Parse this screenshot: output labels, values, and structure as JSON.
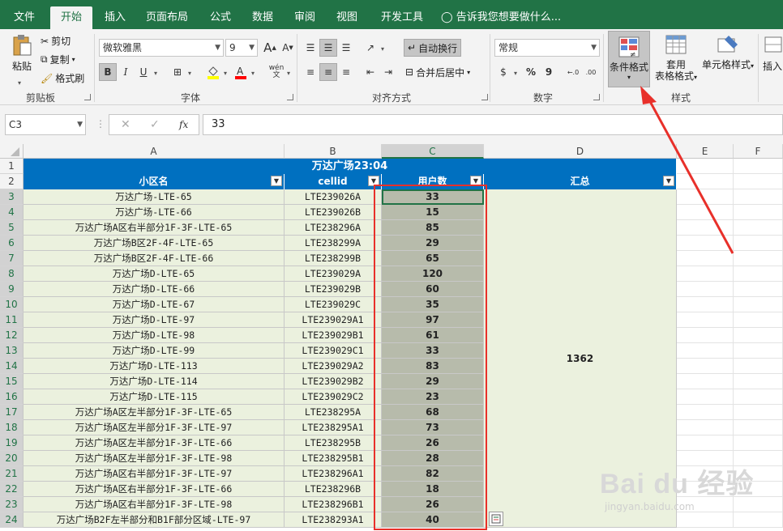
{
  "tabs": [
    {
      "label": "文件",
      "active": false
    },
    {
      "label": "开始",
      "active": true
    },
    {
      "label": "插入",
      "active": false
    },
    {
      "label": "页面布局",
      "active": false
    },
    {
      "label": "公式",
      "active": false
    },
    {
      "label": "数据",
      "active": false
    },
    {
      "label": "审阅",
      "active": false
    },
    {
      "label": "视图",
      "active": false
    },
    {
      "label": "开发工具",
      "active": false
    }
  ],
  "tell_me": "告诉我您想要做什么...",
  "ribbon": {
    "clipboard": {
      "paste": "粘贴",
      "cut": "剪切",
      "copy": "复制",
      "format_painter": "格式刷",
      "label": "剪贴板"
    },
    "font": {
      "name": "微软雅黑",
      "size": "9",
      "bold": "B",
      "italic": "I",
      "underline": "U",
      "grow": "A",
      "shrink": "A",
      "phonetic": "wén",
      "label": "字体"
    },
    "alignment": {
      "wrap": "自动换行",
      "merge": "合并后居中",
      "label": "对齐方式"
    },
    "number": {
      "format": "常规",
      "percent": "%",
      "comma": "9",
      "inc_dec": ".00",
      "label": "数字"
    },
    "styles": {
      "conditional": "条件格式",
      "table_l1": "套用",
      "table_l2": "表格格式",
      "cell_styles": "单元格样式",
      "label": "样式"
    },
    "insert": "插入"
  },
  "formula_bar": {
    "name_box": "C3",
    "fx": "fx",
    "value": "33"
  },
  "columns": [
    {
      "label": "A",
      "selected": false
    },
    {
      "label": "B",
      "selected": false
    },
    {
      "label": "C",
      "selected": true
    },
    {
      "label": "D",
      "selected": false
    },
    {
      "label": "E",
      "selected": false
    },
    {
      "label": "F",
      "selected": false
    }
  ],
  "sheet": {
    "title": "万达广场23:04",
    "headers": [
      "小区名",
      "cellid",
      "用户数",
      "汇总"
    ],
    "total": "1362",
    "rows": [
      {
        "num": "3",
        "name": "万达广场-LTE-65",
        "cellid": "LTE239026A",
        "users": "33"
      },
      {
        "num": "4",
        "name": "万达广场-LTE-66",
        "cellid": "LTE239026B",
        "users": "15"
      },
      {
        "num": "5",
        "name": "万达广场A区右半部分1F-3F-LTE-65",
        "cellid": "LTE238296A",
        "users": "85"
      },
      {
        "num": "6",
        "name": "万达广场B区2F-4F-LTE-65",
        "cellid": "LTE238299A",
        "users": "29"
      },
      {
        "num": "7",
        "name": "万达广场B区2F-4F-LTE-66",
        "cellid": "LTE238299B",
        "users": "65"
      },
      {
        "num": "8",
        "name": "万达广场D-LTE-65",
        "cellid": "LTE239029A",
        "users": "120"
      },
      {
        "num": "9",
        "name": "万达广场D-LTE-66",
        "cellid": "LTE239029B",
        "users": "60"
      },
      {
        "num": "10",
        "name": "万达广场D-LTE-67",
        "cellid": "LTE239029C",
        "users": "35"
      },
      {
        "num": "11",
        "name": "万达广场D-LTE-97",
        "cellid": "LTE239029A1",
        "users": "97"
      },
      {
        "num": "12",
        "name": "万达广场D-LTE-98",
        "cellid": "LTE239029B1",
        "users": "61"
      },
      {
        "num": "13",
        "name": "万达广场D-LTE-99",
        "cellid": "LTE239029C1",
        "users": "33"
      },
      {
        "num": "14",
        "name": "万达广场D-LTE-113",
        "cellid": "LTE239029A2",
        "users": "83"
      },
      {
        "num": "15",
        "name": "万达广场D-LTE-114",
        "cellid": "LTE239029B2",
        "users": "29"
      },
      {
        "num": "16",
        "name": "万达广场D-LTE-115",
        "cellid": "LTE239029C2",
        "users": "23"
      },
      {
        "num": "17",
        "name": "万达广场A区左半部分1F-3F-LTE-65",
        "cellid": "LTE238295A",
        "users": "68"
      },
      {
        "num": "18",
        "name": "万达广场A区左半部分1F-3F-LTE-97",
        "cellid": "LTE238295A1",
        "users": "73"
      },
      {
        "num": "19",
        "name": "万达广场A区左半部分1F-3F-LTE-66",
        "cellid": "LTE238295B",
        "users": "26"
      },
      {
        "num": "20",
        "name": "万达广场A区左半部分1F-3F-LTE-98",
        "cellid": "LTE238295B1",
        "users": "28"
      },
      {
        "num": "21",
        "name": "万达广场A区右半部分1F-3F-LTE-97",
        "cellid": "LTE238296A1",
        "users": "82"
      },
      {
        "num": "22",
        "name": "万达广场A区右半部分1F-3F-LTE-66",
        "cellid": "LTE238296B",
        "users": "18"
      },
      {
        "num": "23",
        "name": "万达广场A区右半部分1F-3F-LTE-98",
        "cellid": "LTE238296B1",
        "users": "26"
      },
      {
        "num": "24",
        "name": "万达广场B2F左半部分和B1F部分区域-LTE-97",
        "cellid": "LTE238293A1",
        "users": "40"
      }
    ]
  },
  "watermark": {
    "brand": "Bai du 经验",
    "url": "jingyan.baidu.com"
  },
  "colors": {
    "excel_green": "#217346",
    "header_blue": "#0070c0",
    "cell_green": "#ebf1de",
    "selection_gray": "#b7bbab",
    "annotation_red": "#e8302a"
  }
}
